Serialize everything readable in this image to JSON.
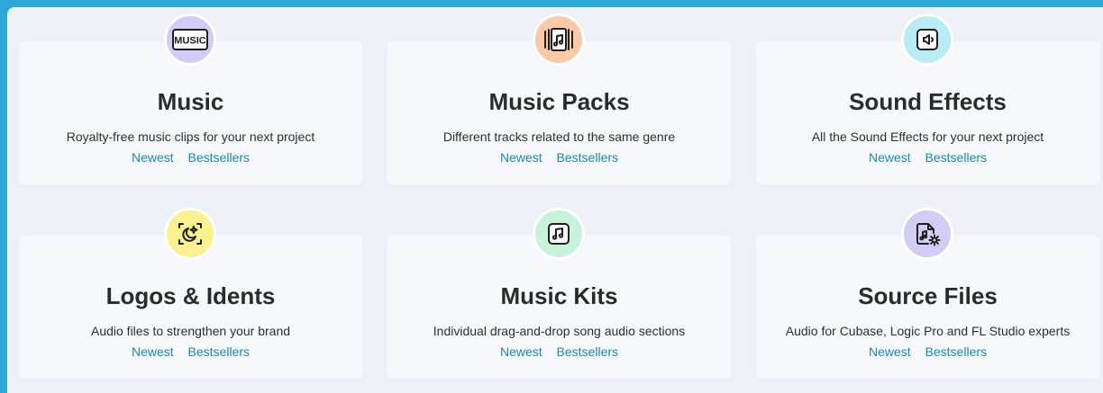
{
  "cards": [
    {
      "title": "Music",
      "description": "Royalty-free music clips for your next project",
      "link_newest": "Newest",
      "link_bestsellers": "Bestsellers",
      "icon": "music-text-icon",
      "icon_text": "MUSIC",
      "badge_color": "#cfcdf6"
    },
    {
      "title": "Music Packs",
      "description": "Different tracks related to the same genre",
      "link_newest": "Newest",
      "link_bestsellers": "Bestsellers",
      "icon": "music-pack-icon",
      "badge_color": "#fbc9a6"
    },
    {
      "title": "Sound Effects",
      "description": "All the Sound Effects for your next project",
      "link_newest": "Newest",
      "link_bestsellers": "Bestsellers",
      "icon": "speaker-icon",
      "badge_color": "#b9ecf4"
    },
    {
      "title": "Logos & Idents",
      "description": "Audio files to strengthen your brand",
      "link_newest": "Newest",
      "link_bestsellers": "Bestsellers",
      "icon": "sparkle-moon-icon",
      "badge_color": "#fbf18f"
    },
    {
      "title": "Music Kits",
      "description": "Individual drag-and-drop song audio sections",
      "link_newest": "Newest",
      "link_bestsellers": "Bestsellers",
      "icon": "music-note-square-icon",
      "badge_color": "#c9f2da"
    },
    {
      "title": "Source Files",
      "description": "Audio for Cubase, Logic Pro and FL Studio experts",
      "link_newest": "Newest",
      "link_bestsellers": "Bestsellers",
      "icon": "music-file-gear-icon",
      "badge_color": "#d2cdf5"
    }
  ],
  "colors": {
    "outer_background": "#2ea8d6",
    "page_background": "#edf0f7",
    "card_background": "#f7f8fb",
    "title": "#2b2b2b",
    "link": "#1789b3"
  }
}
